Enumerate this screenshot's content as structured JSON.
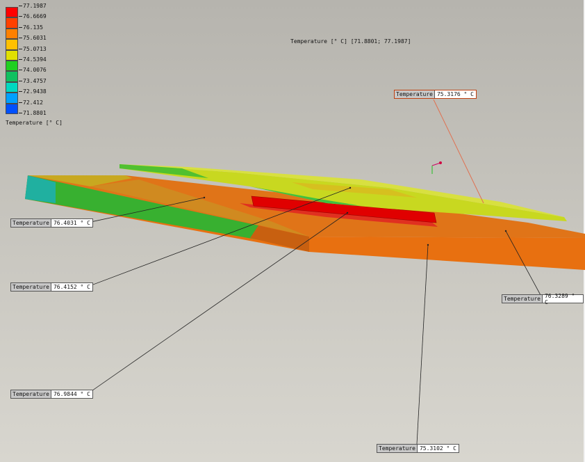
{
  "legend": {
    "caption": "Temperature [° C]",
    "ticks": [
      "77.1987",
      "76.6669",
      "76.135",
      "75.6031",
      "75.0713",
      "74.5394",
      "74.0076",
      "73.4757",
      "72.9438",
      "72.412",
      "71.8801"
    ],
    "colors": [
      "#ff0000",
      "#ff4000",
      "#ff8000",
      "#ffc000",
      "#e0e000",
      "#20d020",
      "#10c060",
      "#00d8c0",
      "#00a0ff",
      "#0050ff",
      "#0000ff"
    ]
  },
  "scene_title": "Temperature [° C] [71.8801; 77.1987]",
  "probes": [
    {
      "label": "Temperature",
      "value": "75.3176 ° C"
    },
    {
      "label": "Temperature",
      "value": "76.4031 ° C"
    },
    {
      "label": "Temperature",
      "value": "76.4152 ° C"
    },
    {
      "label": "Temperature",
      "value": "76.3289 ° C"
    },
    {
      "label": "Temperature",
      "value": "76.9844 ° C"
    },
    {
      "label": "Temperature",
      "value": "75.3102 ° C"
    }
  ]
}
